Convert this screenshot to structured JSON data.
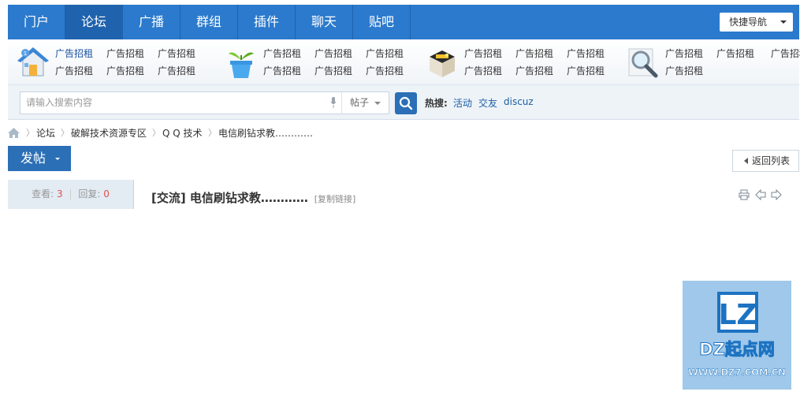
{
  "nav": {
    "items": [
      "门户",
      "论坛",
      "广播",
      "群组",
      "插件",
      "聊天",
      "贴吧"
    ],
    "active_index": 1,
    "quick_nav": "快捷导航"
  },
  "ads": {
    "label": "广告招租",
    "groups": [
      {
        "icon": "house-icon",
        "first_link_highlighted": true
      },
      {
        "icon": "plant-pot-icon",
        "first_link_highlighted": false
      },
      {
        "icon": "treasure-box-icon",
        "first_link_highlighted": false
      },
      {
        "icon": "magnifier-icon",
        "first_link_highlighted": false
      }
    ]
  },
  "search": {
    "placeholder": "请输入搜索内容",
    "type": "帖子",
    "hot_label": "热搜:",
    "hot_terms": [
      "活动",
      "交友",
      "discuz"
    ]
  },
  "breadcrumb": [
    "论坛",
    "破解技术资源专区",
    "Q Q 技术",
    "电信刷钻求教…………"
  ],
  "post_button": "发帖",
  "return_button": "返回列表",
  "stats": {
    "views_label": "查看:",
    "views": "3",
    "replies_label": "回复:",
    "replies": "0"
  },
  "thread": {
    "title": "[交流] 电信刷钻求教…………",
    "copy_link": "[复制链接]"
  },
  "logo": {
    "mark": "LZ",
    "name": "DZ起点网",
    "url": "WWW.DZ7.COM.CN"
  },
  "colors": {
    "nav_bg": "#2b7acd",
    "nav_active": "#1f62ad",
    "button_blue": "#2b6fb6",
    "link_blue": "#1a5fa5",
    "count_red": "#e05050"
  }
}
